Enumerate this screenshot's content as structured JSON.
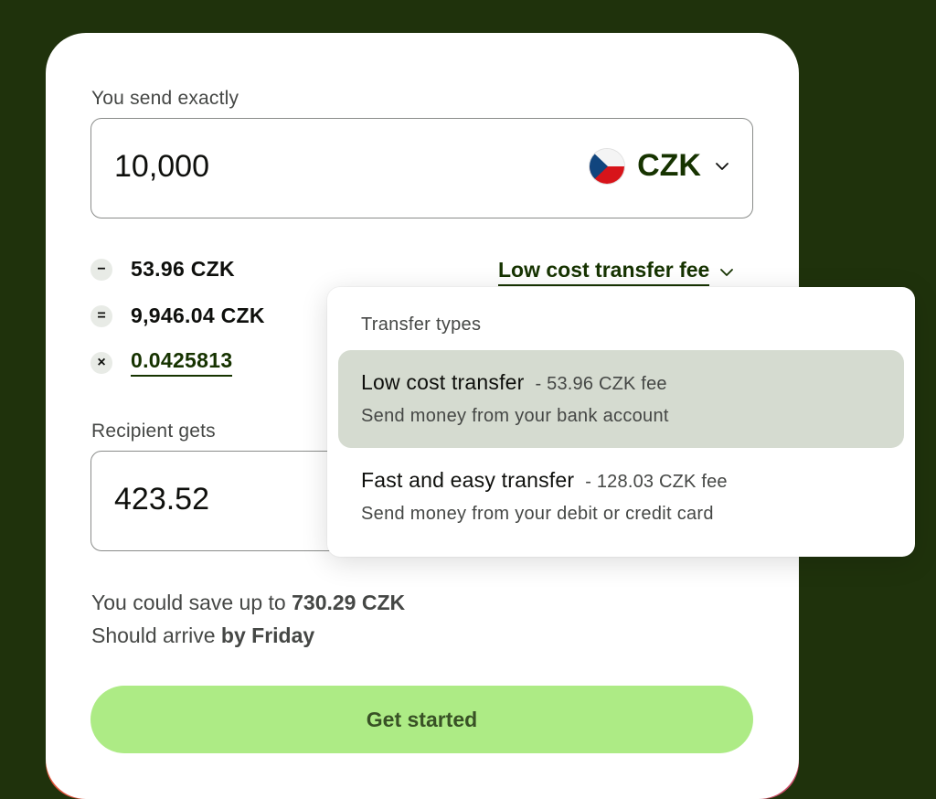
{
  "send": {
    "label": "You send exactly",
    "amount": "10,000",
    "currency": "CZK"
  },
  "breakdown": {
    "fee": {
      "symbol": "−",
      "value": "53.96 CZK"
    },
    "converted": {
      "symbol": "=",
      "value": "9,946.04 CZK"
    },
    "rate": {
      "symbol": "×",
      "value": "0.0425813"
    },
    "fee_type": "Low cost transfer fee"
  },
  "receive": {
    "label": "Recipient gets",
    "amount": "423.52"
  },
  "info": {
    "save_prefix": "You could save up to ",
    "save_amount": "730.29 CZK",
    "arrive_prefix": "Should arrive ",
    "arrive_when": "by Friday"
  },
  "cta_label": "Get started",
  "dropdown": {
    "title": "Transfer types",
    "options": [
      {
        "name": "Low cost transfer",
        "fee": "- 53.96 CZK fee",
        "desc": "Send money from your bank account",
        "selected": true
      },
      {
        "name": "Fast and easy transfer",
        "fee": "- 128.03 CZK fee",
        "desc": "Send money from your debit or credit card",
        "selected": false
      }
    ]
  },
  "colors": {
    "background": "#1f320c",
    "accent_green": "#9fe870",
    "forest_green": "#163300",
    "selected_option": "#d5dbd0"
  },
  "icons": {
    "flag": "czech-flag-icon",
    "chevron": "chevron-down-icon"
  }
}
